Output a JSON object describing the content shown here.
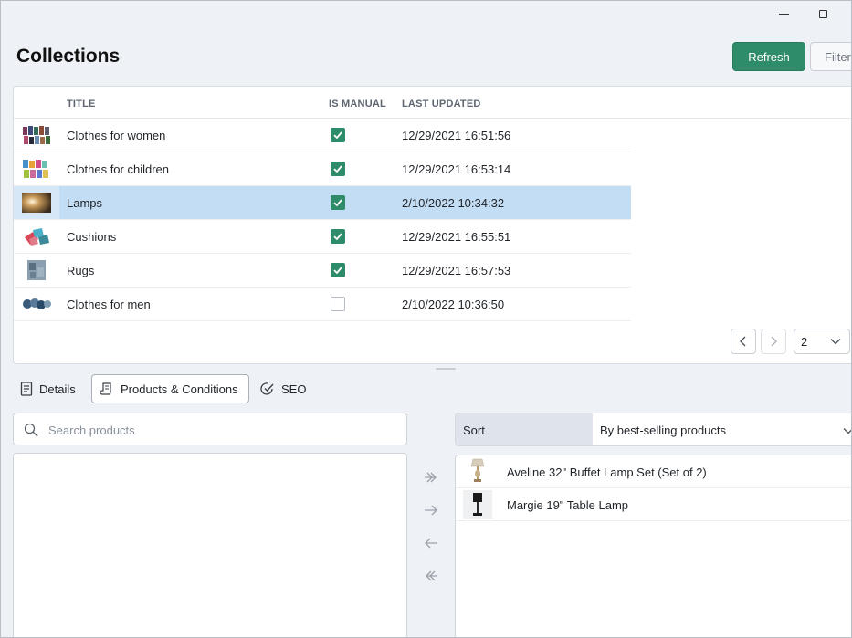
{
  "page": {
    "title": "Collections"
  },
  "toolbar": {
    "refresh_label": "Refresh",
    "filter_label": "Filter"
  },
  "grid": {
    "columns": {
      "title": "TITLE",
      "is_manual": "IS MANUAL",
      "last_updated": "LAST UPDATED"
    },
    "rows": [
      {
        "title": "Clothes for women",
        "is_manual": true,
        "last_updated": "12/29/2021 16:51:56",
        "thumb": "clothes-women-thumbnail"
      },
      {
        "title": "Clothes for children",
        "is_manual": true,
        "last_updated": "12/29/2021 16:53:14",
        "thumb": "clothes-children-thumbnail"
      },
      {
        "title": "Lamps",
        "is_manual": true,
        "last_updated": "2/10/2022 10:34:32",
        "thumb": "lamps-thumbnail",
        "selected": true
      },
      {
        "title": "Cushions",
        "is_manual": true,
        "last_updated": "12/29/2021 16:55:51",
        "thumb": "cushions-thumbnail"
      },
      {
        "title": "Rugs",
        "is_manual": true,
        "last_updated": "12/29/2021 16:57:53",
        "thumb": "rugs-thumbnail"
      },
      {
        "title": "Clothes for men",
        "is_manual": false,
        "last_updated": "2/10/2022 10:36:50",
        "thumb": "clothes-men-thumbnail"
      }
    ],
    "page_size": "2"
  },
  "tabs": [
    {
      "label": "Details",
      "icon": "document-icon"
    },
    {
      "label": "Products & Conditions",
      "icon": "scroll-icon",
      "active": true
    },
    {
      "label": "SEO",
      "icon": "seo-check-icon"
    }
  ],
  "search": {
    "placeholder": "Search products",
    "value": ""
  },
  "sort": {
    "label": "Sort",
    "value": "By best-selling products"
  },
  "products": [
    {
      "name": "Aveline 32\" Buffet Lamp Set (Set of 2)",
      "thumb": "buffet-lamp-thumbnail"
    },
    {
      "name": "Margie 19\" Table Lamp",
      "thumb": "table-lamp-thumbnail"
    }
  ],
  "colors": {
    "accent": "#2e8c6a",
    "selection": "#c3ddf5",
    "sort_label_bg": "#dfe4ec"
  }
}
